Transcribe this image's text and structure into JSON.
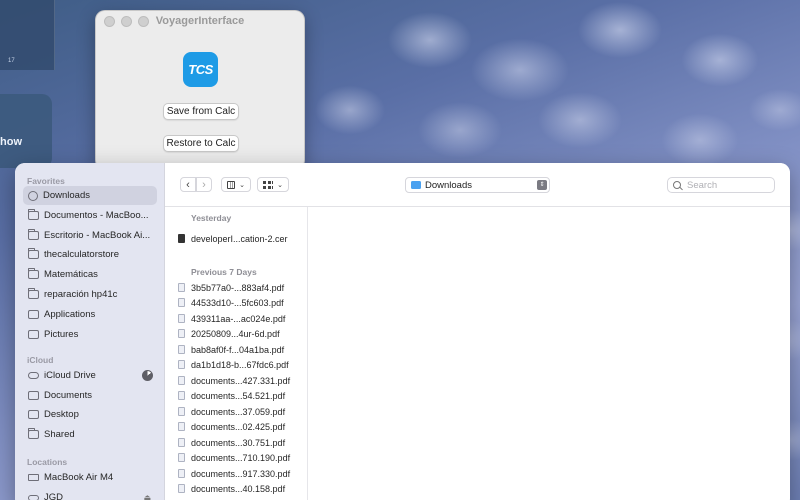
{
  "desktop": {
    "left_number": "17",
    "left_card_label": "how"
  },
  "voyager": {
    "title": "VoyagerInterface",
    "logo_text": "TCS",
    "save_label": "Save from Calc",
    "restore_label": "Restore to Calc"
  },
  "finder": {
    "sidebar": {
      "favorites_header": "Favorites",
      "favorites": [
        {
          "label": "Downloads",
          "icon": "download-icon"
        },
        {
          "label": "Documentos - MacBoo...",
          "icon": "folder-icon"
        },
        {
          "label": "Escritorio - MacBook Ai...",
          "icon": "folder-icon"
        },
        {
          "label": "thecalculatorstore",
          "icon": "folder-icon"
        },
        {
          "label": "Matemáticas",
          "icon": "folder-icon"
        },
        {
          "label": "reparación hp41c",
          "icon": "folder-icon"
        },
        {
          "label": "Applications",
          "icon": "applications-icon"
        },
        {
          "label": "Pictures",
          "icon": "pictures-icon"
        }
      ],
      "icloud_header": "iCloud",
      "icloud": [
        {
          "label": "iCloud Drive",
          "icon": "cloud-icon"
        },
        {
          "label": "Documents",
          "icon": "document-icon"
        },
        {
          "label": "Desktop",
          "icon": "desktop-icon"
        },
        {
          "label": "Shared",
          "icon": "shared-folder-icon"
        }
      ],
      "locations_header": "Locations",
      "locations": [
        {
          "label": "MacBook Air M4",
          "icon": "laptop-icon"
        },
        {
          "label": "JGD",
          "icon": "drive-icon"
        }
      ]
    },
    "toolbar": {
      "back": "‹",
      "forward": "›",
      "view_chevron": "⌄",
      "location": "Downloads",
      "search_placeholder": "Search"
    },
    "groups": {
      "yesterday_header": "Yesterday",
      "yesterday_files": [
        "developerI...cation-2.cer"
      ],
      "previous_header": "Previous 7 Days",
      "previous_files": [
        "3b5b77a0-...883af4.pdf",
        "44533d10-...5fc603.pdf",
        "439311aa-...ac024e.pdf",
        "20250809...4ur-6d.pdf",
        "bab8af0f-f...04a1ba.pdf",
        "da1b1d18-b...67fdc6.pdf",
        "documents...427.331.pdf",
        "documents...54.521.pdf",
        "documents...37.059.pdf",
        "documents...02.425.pdf",
        "documents...30.751.pdf",
        "documents...710.190.pdf",
        "documents...917.330.pdf",
        "documents...40.158.pdf"
      ]
    }
  }
}
